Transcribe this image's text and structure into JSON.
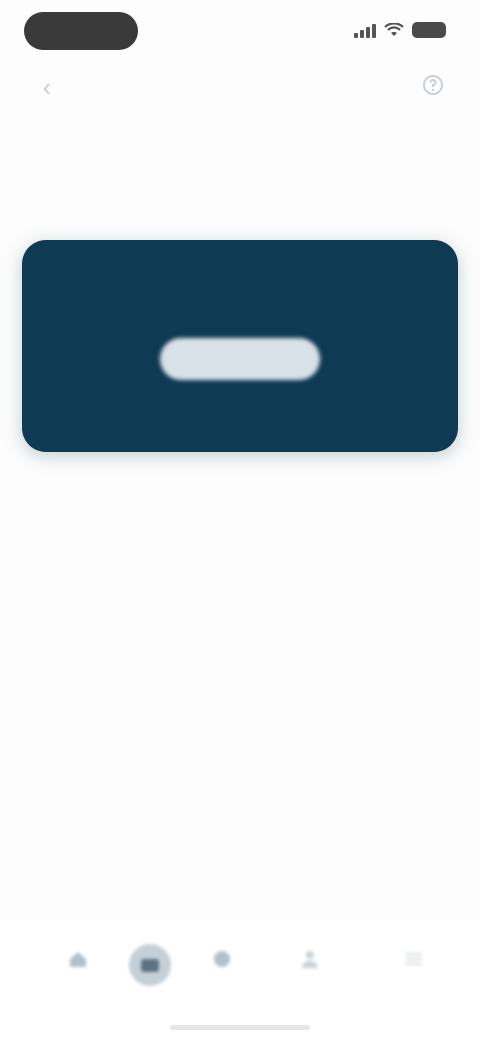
{
  "status_bar": {
    "icons": [
      "signal-icon",
      "wifi-icon",
      "battery-icon"
    ]
  },
  "top_nav": {
    "icons": [
      "back-icon",
      "help-icon"
    ]
  },
  "content": {
    "title": "",
    "promo_card": {
      "caption": "",
      "button_label": "",
      "link_label": "",
      "background_color": "#0f3a54"
    }
  },
  "tab_bar": {
    "items": [
      {
        "icon": "home-icon",
        "label": ""
      },
      {
        "icon": "wallet-icon",
        "label": "",
        "active": true
      },
      {
        "icon": "chart-icon",
        "label": ""
      },
      {
        "icon": "person-icon",
        "label": ""
      },
      {
        "icon": "menu-icon",
        "label": ""
      }
    ]
  },
  "colors": {
    "accent": "#0f3a54",
    "muted": "#c4d0d8"
  }
}
